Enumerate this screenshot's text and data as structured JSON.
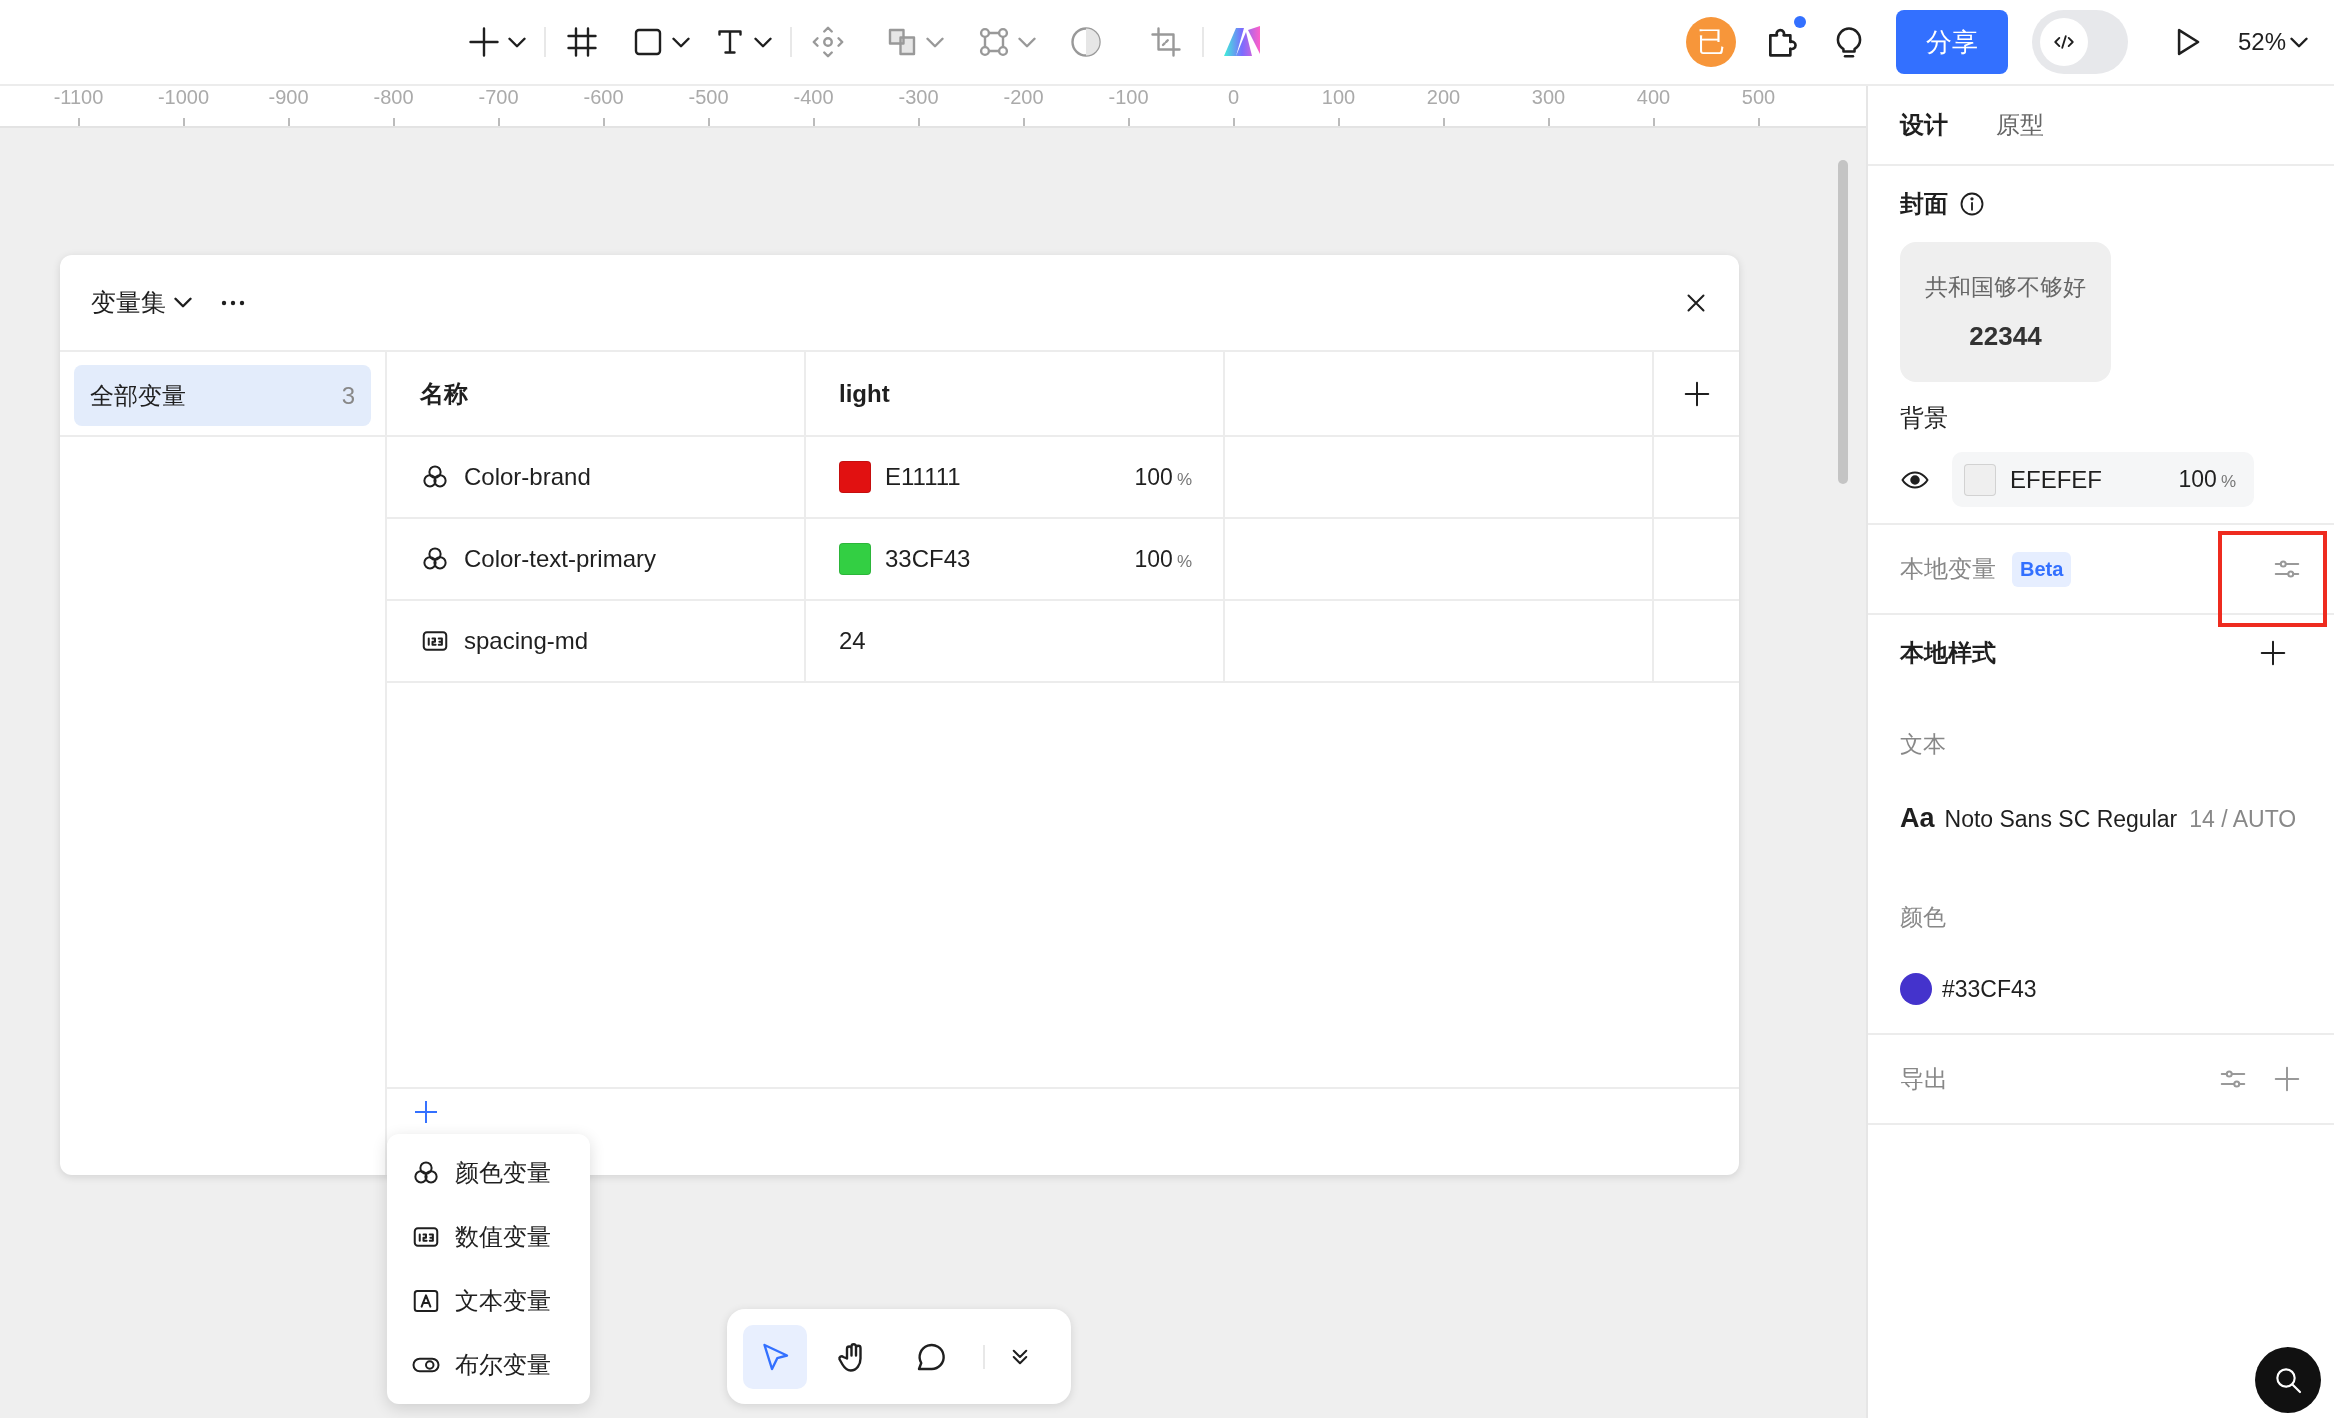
{
  "toolbar": {
    "avatar": "已",
    "share": "分享",
    "code_mode_on": false,
    "zoom": "52%"
  },
  "ruler": {
    "labels": [
      "-1100",
      "-1000",
      "-900",
      "-800",
      "-700",
      "-600",
      "-500",
      "-400",
      "-300",
      "-200",
      "-100",
      "0",
      "100",
      "200",
      "300",
      "400",
      "500"
    ]
  },
  "variables_panel": {
    "collection": "变量集",
    "collections": [
      {
        "label": "全部变量",
        "count": "3",
        "selected": true
      }
    ],
    "columns": [
      "名称",
      "light"
    ],
    "rows": [
      {
        "kind": "color",
        "name": "Color-brand",
        "value": "E11111",
        "opacity": "100",
        "unit": "%"
      },
      {
        "kind": "color",
        "name": "Color-text-primary",
        "value": "33CF43",
        "opacity": "100",
        "unit": "%"
      },
      {
        "kind": "number",
        "name": "spacing-md",
        "value": "24"
      }
    ]
  },
  "create_menu": [
    {
      "kind": "color",
      "label": "颜色变量"
    },
    {
      "kind": "number",
      "label": "数值变量"
    },
    {
      "kind": "text",
      "label": "文本变量"
    },
    {
      "kind": "boolean",
      "label": "布尔变量"
    }
  ],
  "bottom_toolbar": [
    {
      "kind": "pointer",
      "selected": true
    },
    {
      "kind": "hand",
      "selected": false
    },
    {
      "kind": "comment",
      "selected": false
    }
  ],
  "inspector": {
    "tabs": [
      {
        "label": "设计",
        "selected": true
      },
      {
        "label": "原型",
        "selected": false
      }
    ],
    "cover": {
      "title": "封面",
      "lines": [
        "共和国够不够好",
        "22344"
      ]
    },
    "background": {
      "title": "背景",
      "hex": "EFEFEF",
      "opacity": "100",
      "unit": "%"
    },
    "local_variables": {
      "title": "本地变量",
      "badge": "Beta"
    },
    "local_styles": {
      "title": "本地样式",
      "groups": [
        {
          "title": "文本",
          "items": [
            {
              "kind": "text",
              "sample": "Aa",
              "name": "Noto Sans SC Regular",
              "meta": "14 / AUTO"
            }
          ]
        },
        {
          "title": "颜色",
          "items": [
            {
              "kind": "color",
              "name": "#33CF43",
              "color": "#4433cc"
            }
          ]
        }
      ]
    },
    "export": {
      "title": "导出"
    }
  }
}
